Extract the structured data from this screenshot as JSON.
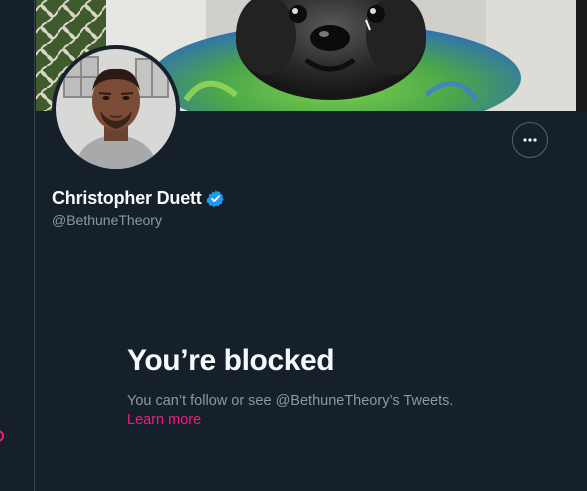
{
  "profile": {
    "display_name": "Christopher Duett",
    "handle": "@BethuneTheory",
    "verified": true
  },
  "blocked": {
    "title": "You’re blocked",
    "description": "You can’t follow or see @BethuneTheory’s Tweets.",
    "learn_more_label": "Learn more"
  },
  "icons": {
    "more": "more-horizontal-icon",
    "verified": "verified-badge-icon"
  },
  "colors": {
    "background": "#15202b",
    "text_primary": "#f7f9f9",
    "text_secondary": "#8b98a5",
    "accent_link": "#f91880",
    "verified_blue": "#1d9bf0"
  }
}
